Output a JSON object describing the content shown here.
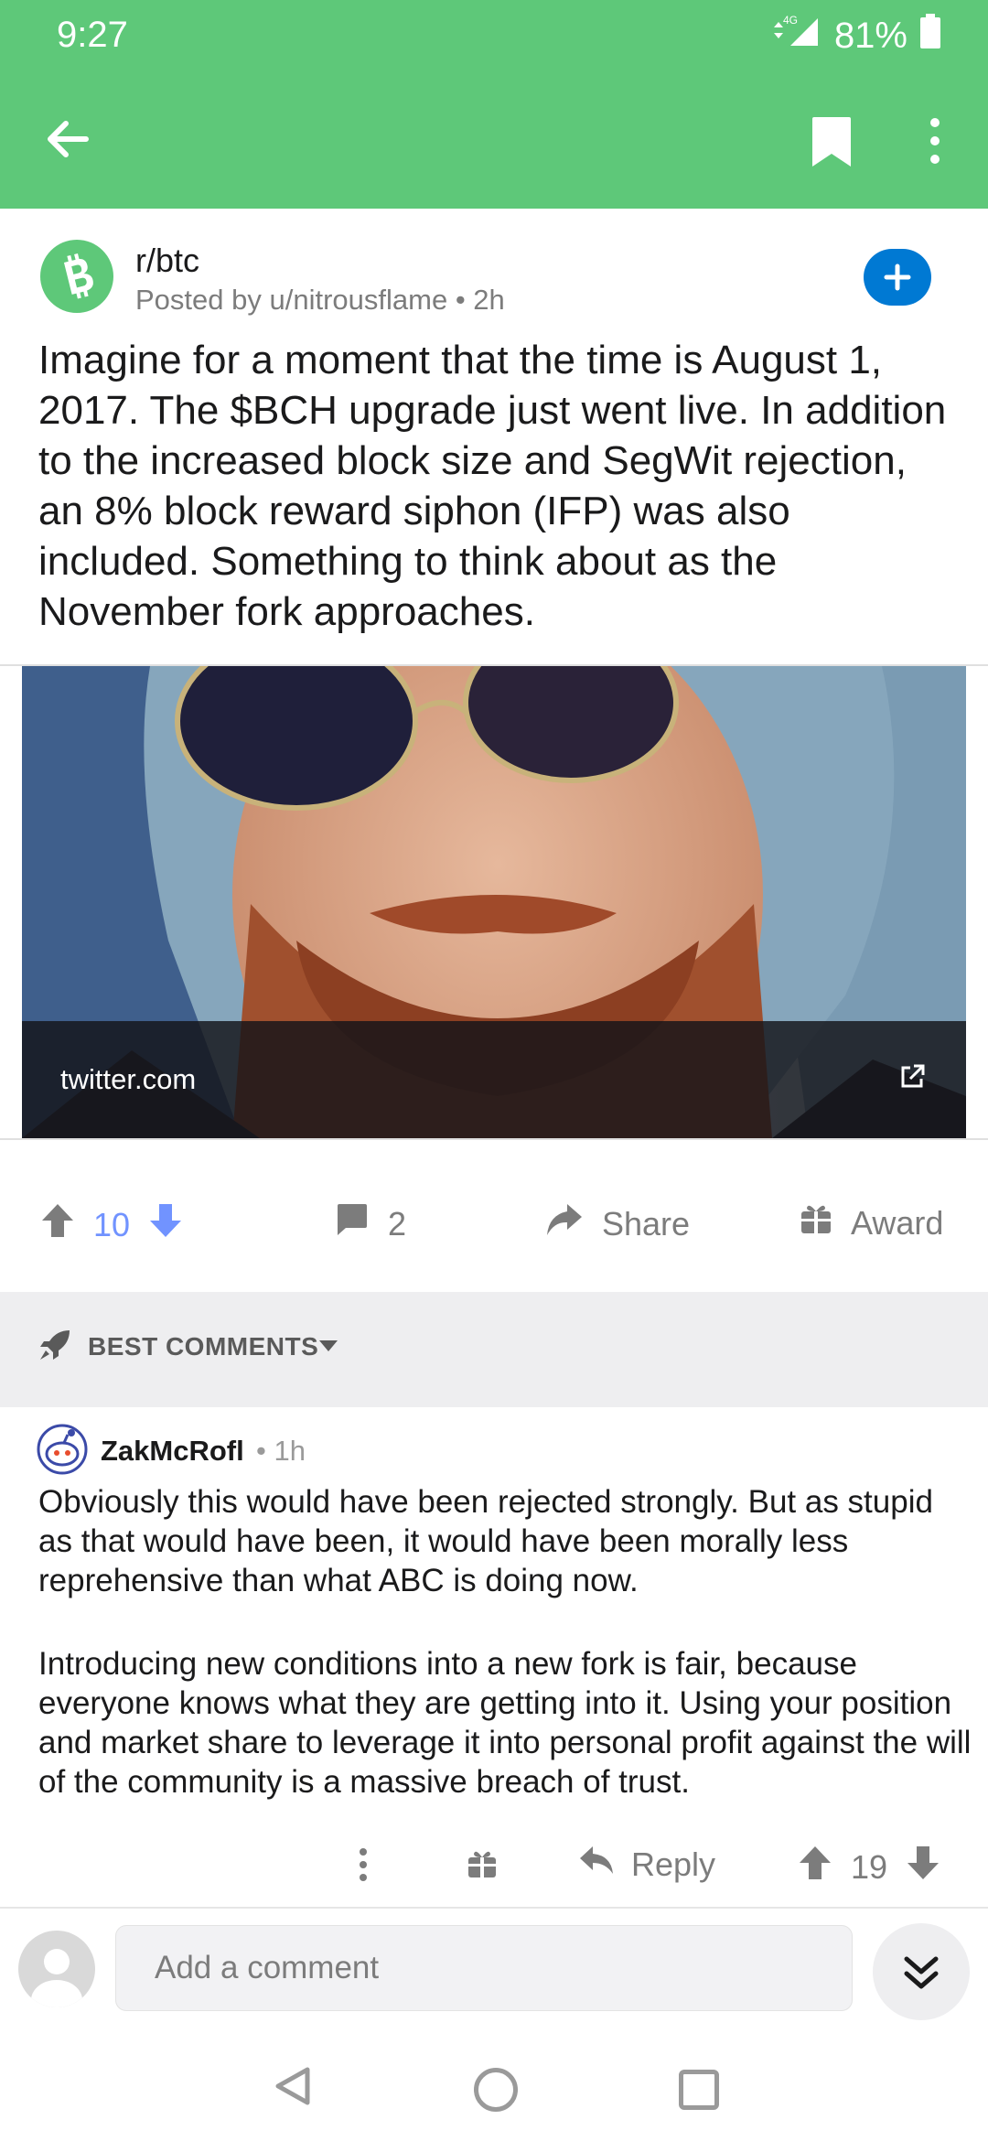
{
  "status": {
    "time": "9:27",
    "network": "4G",
    "battery": "81%"
  },
  "colors": {
    "header": "#5ec879",
    "accent_blue": "#0079d3",
    "upvote_blue": "#7193ff",
    "muted": "#7c7c7c"
  },
  "post": {
    "subreddit": "r/btc",
    "posted_by": "Posted by u/nitrousflame",
    "age": "2h",
    "title": "Imagine for a moment that the time is August 1, 2017. The $BCH upgrade just went live. In addition to the increased block size and SegWit rejection, an 8% block reward siphon (IFP) was also included. Something to think about as the November fork approaches.",
    "link_domain": "twitter.com",
    "score": "10",
    "comments": "2",
    "share_label": "Share",
    "award_label": "Award"
  },
  "comments_sort": "BEST COMMENTS",
  "comment": {
    "author": "ZakMcRofl",
    "age": "1h",
    "body_p1": "Obviously this would have been rejected strongly. But as stupid as that would have been, it would have been morally less reprehensive than what ABC is doing now.",
    "body_p2": "Introducing new conditions into a new fork is fair, because everyone knows what they are getting into it. Using your position and market share to leverage it into personal profit against the will of the community is a massive breach of trust.",
    "reply_label": "Reply",
    "score": "19"
  },
  "compose": {
    "placeholder": "Add a comment"
  }
}
